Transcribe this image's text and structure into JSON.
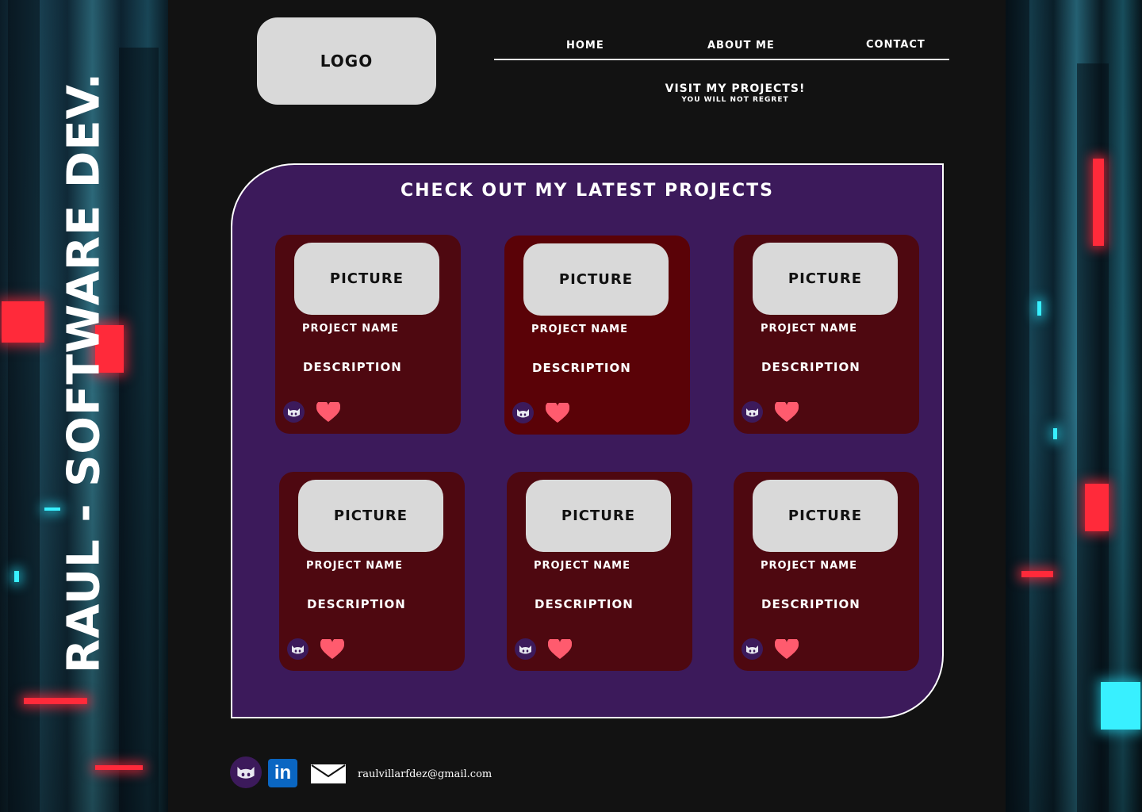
{
  "side": {
    "title": "RAUL - SOFTWARE DEV."
  },
  "header": {
    "logo": "LOGO",
    "nav": {
      "home": "HOME",
      "about": "ABOUT ME",
      "contact": "CONTACT"
    },
    "visit_title": "VISIT MY PROJECTS!",
    "visit_sub": "YOU WILL NOT REGRET"
  },
  "projects": {
    "title": "CHECK OUT MY LATEST PROJECTS",
    "cards": [
      {
        "picture": "PICTURE",
        "name": "PROJECT NAME",
        "description": "DESCRIPTION"
      },
      {
        "picture": "PICTURE",
        "name": "PROJECT NAME",
        "description": "DESCRIPTION"
      },
      {
        "picture": "PICTURE",
        "name": "PROJECT NAME",
        "description": "DESCRIPTION"
      },
      {
        "picture": "PICTURE",
        "name": "PROJECT NAME",
        "description": "DESCRIPTION"
      },
      {
        "picture": "PICTURE",
        "name": "PROJECT NAME",
        "description": "DESCRIPTION"
      },
      {
        "picture": "PICTURE",
        "name": "PROJECT NAME",
        "description": "DESCRIPTION"
      }
    ]
  },
  "footer": {
    "linkedin_glyph": "in",
    "email": "raulvillarfdez@gmail.com"
  },
  "icons": {
    "github": "github-icon",
    "heart": "heart-icon",
    "linkedin": "linkedin-icon",
    "mail": "mail-icon"
  },
  "colors": {
    "background": "#121212",
    "panel": "#3c1a5b",
    "card": "#4e0810",
    "card_alt": "#5a0207",
    "placeholder": "#d9d9d9",
    "heart": "#ff5b6e",
    "linkedin": "#0a66c2"
  }
}
